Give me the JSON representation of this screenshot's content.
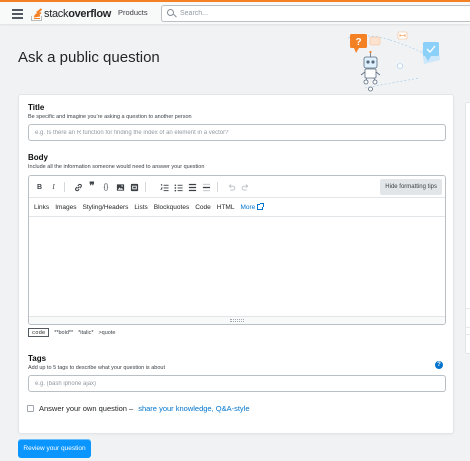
{
  "header": {
    "logo_text_light": "stack",
    "logo_text_bold": "overflow",
    "products_label": "Products",
    "search_placeholder": "Search..."
  },
  "page": {
    "title": "Ask a public question"
  },
  "form": {
    "title_label": "Title",
    "title_desc": "Be specific and imagine you’re asking a question to another person",
    "title_placeholder": "e.g. Is there an R function for finding the index of an element in a vector?",
    "body_label": "Body",
    "body_desc": "Include all the information someone would need to answer your question",
    "toolbar": {
      "bold": "B",
      "italic": "I",
      "code": "{}",
      "hide_tips": "Hide formatting tips"
    },
    "help_tabs": [
      "Links",
      "Images",
      "Styling/Headers",
      "Lists",
      "Blockquotes",
      "Code",
      "HTML"
    ],
    "more_label": "More",
    "preview_hints": {
      "code": "code",
      "bold": "**bold**",
      "italic": "*italic*",
      "quote": ">quote"
    },
    "tags_label": "Tags",
    "tags_desc": "Add up to 5 tags to describe what your question is about",
    "tags_placeholder": "e.g. (bash iphone ajax)",
    "help_icon": "?",
    "answer_own_text": "Answer your own question –",
    "answer_own_link": "share your knowledge, Q&A-style",
    "review_button": "Review your question"
  },
  "colors": {
    "accent_orange": "#f48225",
    "primary_blue": "#0a95ff",
    "link_blue": "#0074cc",
    "background": "#f1f2f3"
  }
}
